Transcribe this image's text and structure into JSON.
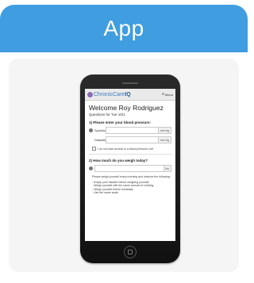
{
  "card": {
    "title": "App"
  },
  "phone_screen": {
    "logo_prefix": "Chronic",
    "logo_suffix": "Care",
    "logo_iq": "IQ",
    "menu_label": "Menu",
    "welcome": "Welcome Roy Rodriguez",
    "subtitle": "Questions for Tue 10/1",
    "question1": "1)  Please enter your blood pressure:",
    "systolic_label": "Systolic",
    "diastolic_label": "Diastolic",
    "bp_unit": "mm Hg",
    "no_cuff_label": "I do not have access to a blood pressure cuff.",
    "question2": "2)  How much do you weigh today?",
    "weight_unit": "lbs",
    "weigh_instructions": "Please weigh yourself every morning and observe the following:",
    "bullets": [
      "- Empty your bladder before weighing yourself.",
      "- Weigh yourself with the same amount of clothing.",
      "- Weigh yourself before breakfast.",
      "- Use the same scale."
    ]
  },
  "colors": {
    "header": "#3f9de0",
    "panel": "#f5f5f5"
  }
}
